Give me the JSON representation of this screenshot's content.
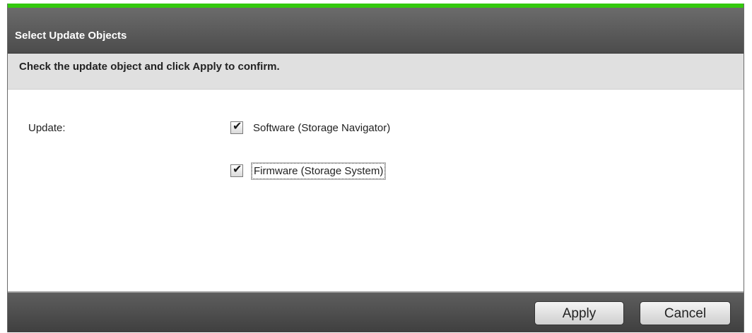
{
  "dialog": {
    "title": "Select Update Objects",
    "instruction": "Check the update object and click Apply to confirm.",
    "accent_color": "#33c90d"
  },
  "form": {
    "field_label": "Update:",
    "options": [
      {
        "label": "Software (Storage Navigator)",
        "checked": true,
        "check_glyph": "✔"
      },
      {
        "label": "Firmware (Storage System)",
        "checked": true,
        "focused": true,
        "check_glyph": "✔"
      }
    ]
  },
  "footer": {
    "apply_label": "Apply",
    "cancel_label": "Cancel"
  }
}
